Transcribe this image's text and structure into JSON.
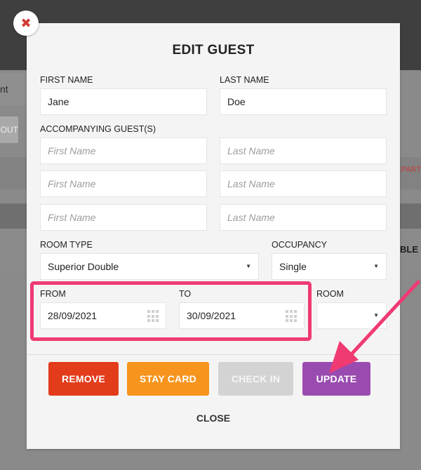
{
  "background": {
    "tab_fragment": "nt",
    "button_fragment": "OUT",
    "column_fragment": "EPART",
    "cell_fragment": "UBLE"
  },
  "modal": {
    "title": "EDIT GUEST",
    "first_name": {
      "label": "FIRST NAME",
      "value": "Jane"
    },
    "last_name": {
      "label": "LAST NAME",
      "value": "Doe"
    },
    "accompanying": {
      "label": "ACCOMPANYING GUEST(S)",
      "rows": [
        {
          "first_placeholder": "First Name",
          "last_placeholder": "Last Name"
        },
        {
          "first_placeholder": "First Name",
          "last_placeholder": "Last Name"
        },
        {
          "first_placeholder": "First Name",
          "last_placeholder": "Last Name"
        }
      ]
    },
    "room_type": {
      "label": "ROOM TYPE",
      "value": "Superior Double"
    },
    "occupancy": {
      "label": "OCCUPANCY",
      "value": "Single"
    },
    "from": {
      "label": "FROM",
      "value": "28/09/2021"
    },
    "to": {
      "label": "TO",
      "value": "30/09/2021"
    },
    "room": {
      "label": "ROOM",
      "value": ""
    },
    "buttons": {
      "remove": "REMOVE",
      "stay_card": "STAY CARD",
      "check_in": "CHECK IN",
      "update": "UPDATE",
      "close": "CLOSE"
    },
    "close_glyph": "✖"
  },
  "colors": {
    "remove": "#e23c1b",
    "stay_card": "#f7941d",
    "check_in_disabled": "#d3d3d3",
    "update": "#9a4bb0",
    "annotation": "#ef3a72"
  }
}
